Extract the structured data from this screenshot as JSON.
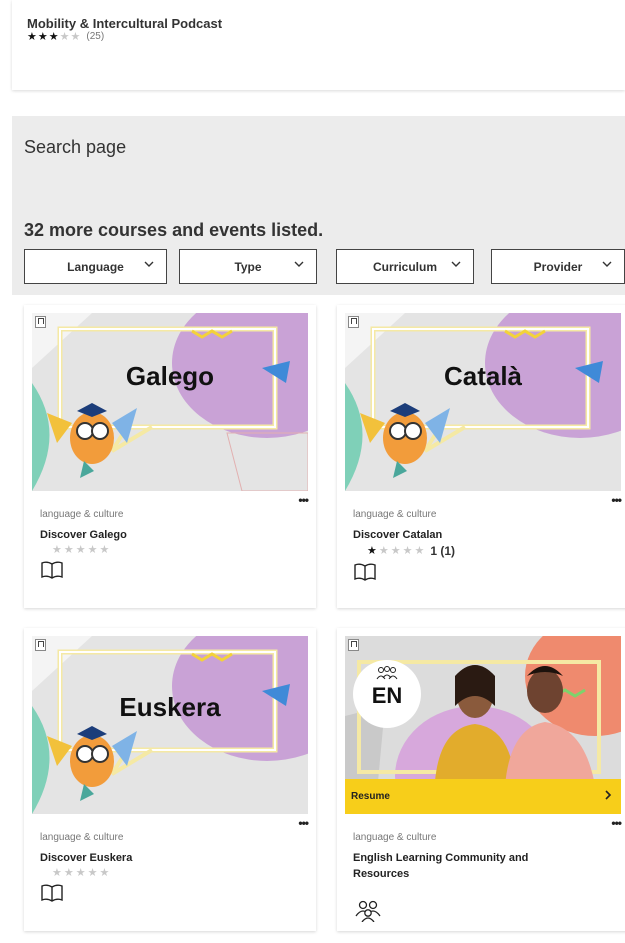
{
  "podcast": {
    "title": "Mobility & Intercultural Podcast",
    "rating": 3,
    "rating_count": "(25)"
  },
  "search": {
    "title": "Search page",
    "results": "32 more courses and events listed.",
    "filters": [
      "Language",
      "Type",
      "Curriculum",
      "Provider"
    ]
  },
  "cards": [
    {
      "thumb_text": "Galego",
      "category": "language & culture",
      "name": "Discover Galego",
      "rating": 0,
      "rating_text": "",
      "icon": "book-icon"
    },
    {
      "thumb_text": "Català",
      "category": "language & culture",
      "name": "Discover Catalan",
      "rating": 1,
      "rating_text": "1 (1)",
      "icon": "book-icon"
    },
    {
      "thumb_text": "Euskera",
      "category": "language & culture",
      "name": "Discover Euskera",
      "rating": 0,
      "rating_text": "",
      "icon": "book-icon"
    },
    {
      "thumb_text": "EN",
      "category": "language & culture",
      "name": "English Learning Community and Resources",
      "resume_label": "Resume",
      "icon": "people-icon"
    }
  ],
  "colors": {
    "resume_yellow": "#f7ce1a",
    "panel_grey": "#ececec",
    "thumb_purple": "#c9a2d6",
    "thumb_green": "#7fd0b8",
    "thumb_blue": "#3f8ad8"
  }
}
